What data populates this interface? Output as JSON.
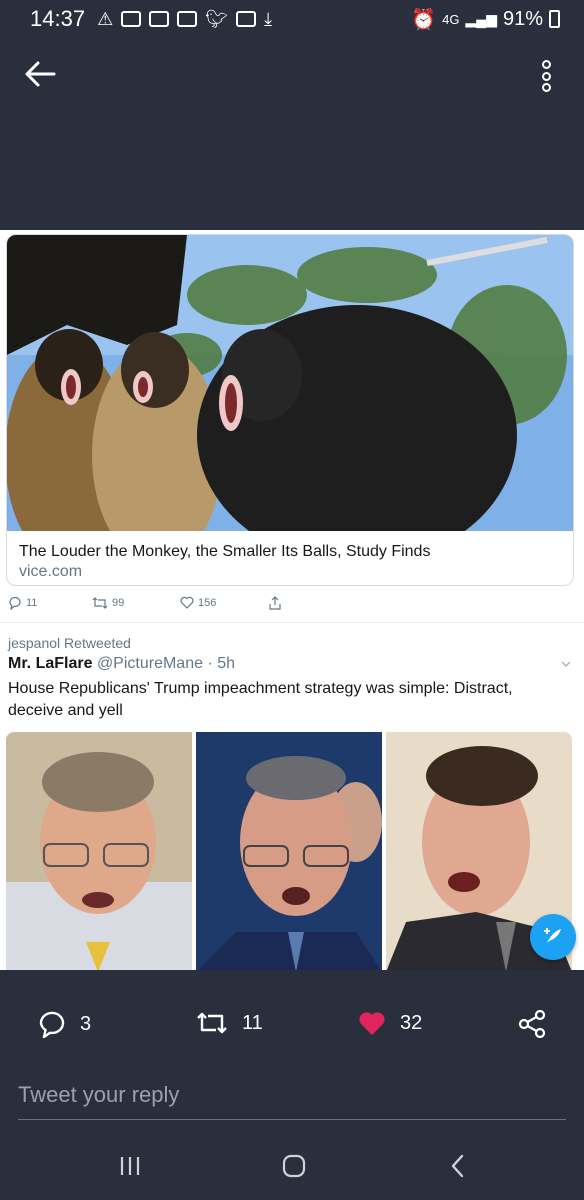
{
  "status_bar": {
    "time": "14:37",
    "network": "4G",
    "battery": "91%"
  },
  "header": {
    "back_icon": "arrow-left-icon",
    "more_icon": "more-vertical-icon"
  },
  "link_card": {
    "title": "The Louder the Monkey, the Smaller Its Balls, Study Finds",
    "domain": "vice.com"
  },
  "tweet_actions_small": {
    "replies": "11",
    "retweets": "99",
    "likes": "156"
  },
  "retweet": {
    "retweeted_by": "jespanol Retweeted",
    "author_name": "Mr. LaFlare",
    "author_handle": "@PictureMane",
    "time": "· 5h",
    "text": "House Republicans' Trump impeachment strategy was simple: Distract, deceive and yell"
  },
  "engagement": {
    "replies": "3",
    "retweets": "11",
    "likes": "32"
  },
  "reply": {
    "placeholder": "Tweet your reply"
  },
  "colors": {
    "background": "#2a2f3d",
    "accent": "#1da1f2",
    "like": "#e0245e"
  }
}
